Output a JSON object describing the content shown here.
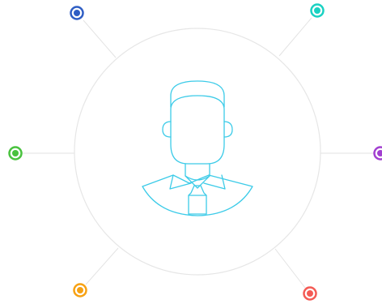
{
  "figure": {
    "center_icon": "businessman-avatar-icon",
    "icon_color": "#3ccbe8",
    "ring_color": "#e6e6e6",
    "connector_color": "#e3e3e3",
    "nodes": [
      {
        "name": "node-top-left",
        "icon": "blue-dot-icon",
        "color": "#2f5ec4"
      },
      {
        "name": "node-top-right",
        "icon": "teal-dot-icon",
        "color": "#19d1c2"
      },
      {
        "name": "node-left",
        "icon": "green-dot-icon",
        "color": "#49c23e"
      },
      {
        "name": "node-right",
        "icon": "purple-dot-icon",
        "color": "#a23fd0"
      },
      {
        "name": "node-bottom-left",
        "icon": "orange-dot-icon",
        "color": "#f7a112"
      },
      {
        "name": "node-bottom-right",
        "icon": "red-dot-icon",
        "color": "#f45b55"
      }
    ]
  }
}
